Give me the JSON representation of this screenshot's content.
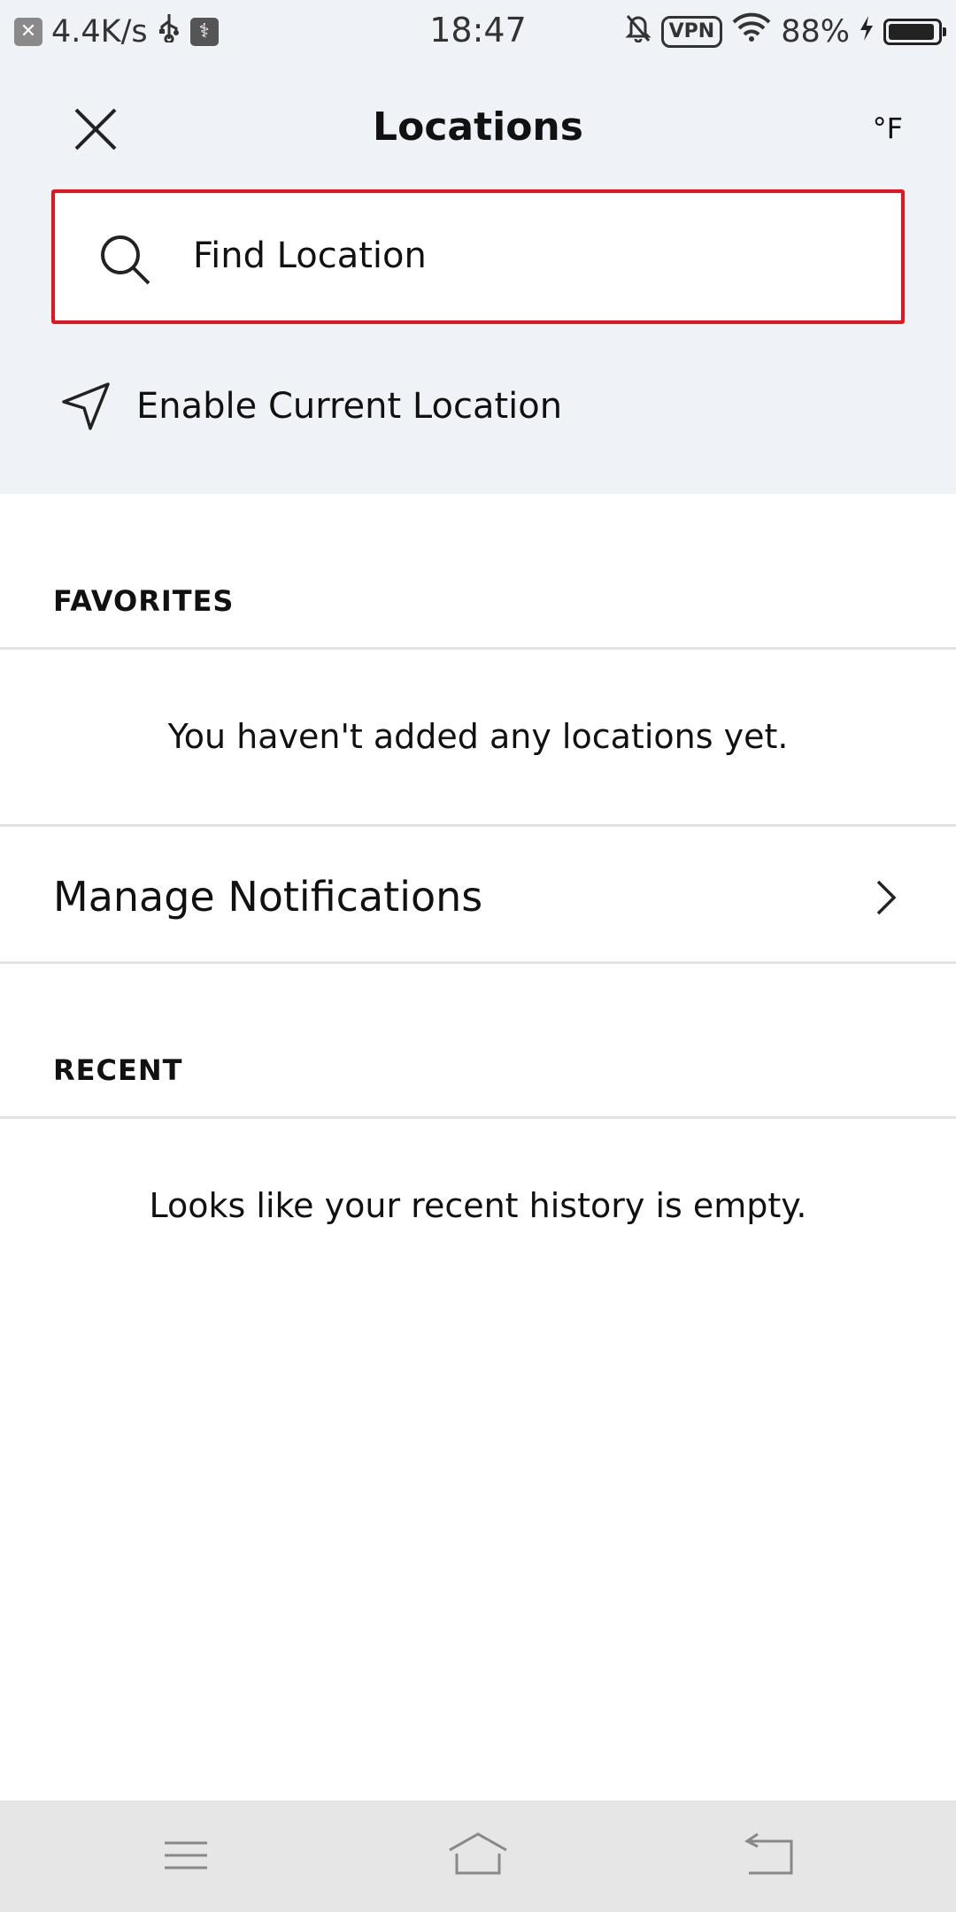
{
  "status_bar": {
    "network_speed": "4.4K/s",
    "time": "18:47",
    "vpn_label": "VPN",
    "battery": "88%"
  },
  "header": {
    "title": "Locations",
    "unit_toggle": "°F"
  },
  "search": {
    "placeholder": "Find Location"
  },
  "enable_location": {
    "label": "Enable Current Location"
  },
  "favorites": {
    "heading": "FAVORITES",
    "empty_message": "You haven't added any locations yet."
  },
  "manage_notifications": {
    "label": "Manage Notifications"
  },
  "recent": {
    "heading": "RECENT",
    "empty_message": "Looks like your recent history is empty."
  },
  "colors": {
    "top_background": "#eff2f7",
    "search_border": "#e8141b",
    "divider": "#e1e3e7",
    "nav_bar": "#e6e6e6"
  },
  "icons": [
    "close-icon",
    "search-icon",
    "navigation-arrow-icon",
    "chevron-right-icon",
    "menu-icon",
    "home-icon",
    "back-icon"
  ]
}
